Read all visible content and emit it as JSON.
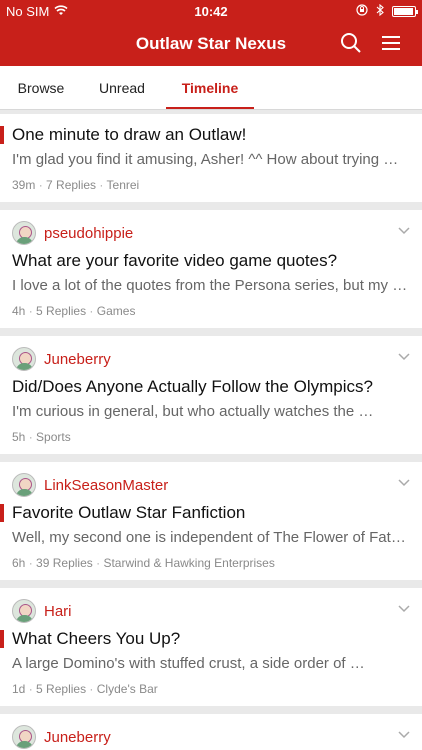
{
  "status_bar": {
    "carrier": "No SIM",
    "time": "10:42"
  },
  "app": {
    "title": "Outlaw Star Nexus"
  },
  "tabs": [
    {
      "label": "Browse"
    },
    {
      "label": "Unread"
    },
    {
      "label": "Timeline",
      "active": true
    }
  ],
  "topics": [
    {
      "user": "",
      "title": "One minute to draw an Outlaw!",
      "excerpt": "I'm glad you find it amusing, Asher! ^^ How about trying …",
      "time": "39m",
      "replies": "7 Replies",
      "category": "Tenrei"
    },
    {
      "user": "pseudohippie",
      "title": "What are your favorite video game quotes?",
      "excerpt": "I love a lot of the quotes from the Persona series, but my …",
      "time": "4h",
      "replies": "5 Replies",
      "category": "Games"
    },
    {
      "user": "Juneberry",
      "title": "Did/Does Anyone Actually Follow the Olympics?",
      "excerpt": "I'm curious in general, but who actually watches the …",
      "time": "5h",
      "replies": "",
      "category": "Sports"
    },
    {
      "user": "LinkSeasonMaster",
      "title": "Favorite Outlaw Star Fanfiction",
      "excerpt": "Well, my second one is independent of The Flower of Fat…",
      "time": "6h",
      "replies": "39 Replies",
      "category": "Starwind & Hawking Enterprises"
    },
    {
      "user": "Hari",
      "title": "What Cheers You Up?",
      "excerpt": "A large Domino's with stuffed crust, a side order of …",
      "time": "1d",
      "replies": "5 Replies",
      "category": "Clyde's Bar"
    },
    {
      "user": "Juneberry",
      "title": "",
      "excerpt": "",
      "time": "",
      "replies": "",
      "category": ""
    }
  ]
}
